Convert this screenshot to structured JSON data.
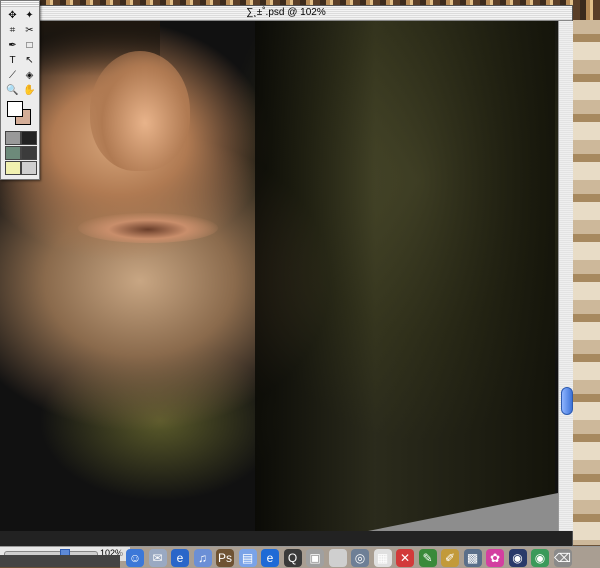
{
  "window": {
    "title": "∑¸±˚.psd @ 102%"
  },
  "status": {
    "zoom_level": "102%",
    "zoom_fraction": 0.66
  },
  "tools": [
    {
      "name": "move-tool-icon",
      "glyph": "✥"
    },
    {
      "name": "wand-tool-icon",
      "glyph": "✦"
    },
    {
      "name": "crop-tool-icon",
      "glyph": "⌗"
    },
    {
      "name": "slice-tool-icon",
      "glyph": "✂"
    },
    {
      "name": "pen-tool-icon",
      "glyph": "✒"
    },
    {
      "name": "rectangle-tool-icon",
      "glyph": "□"
    },
    {
      "name": "type-tool-icon",
      "glyph": "T"
    },
    {
      "name": "path-select-tool-icon",
      "glyph": "↖"
    },
    {
      "name": "eyedropper-tool-icon",
      "glyph": "⟋"
    },
    {
      "name": "paint-bucket-tool-icon",
      "glyph": "◈"
    },
    {
      "name": "zoom-tool-icon",
      "glyph": "🔍"
    },
    {
      "name": "hand-tool-icon",
      "glyph": "✋"
    }
  ],
  "colors": {
    "foreground": "#ffffff",
    "background": "#d4ad97",
    "scroll_thumb": "#3d73d8"
  },
  "dock": [
    {
      "name": "finder-icon",
      "color": "#3c78d8",
      "glyph": "☺"
    },
    {
      "name": "mail-icon",
      "color": "#9aa9c2",
      "glyph": "✉"
    },
    {
      "name": "ie-icon",
      "color": "#2a66c9",
      "glyph": "e"
    },
    {
      "name": "itunes-icon",
      "color": "#6b8fd6",
      "glyph": "♫"
    },
    {
      "name": "photoshop-icon",
      "color": "#6e5232",
      "glyph": "Ps"
    },
    {
      "name": "folder-icon",
      "color": "#7aa3e8",
      "glyph": "▤"
    },
    {
      "name": "internet-explorer-icon",
      "color": "#1e6ad6",
      "glyph": "e"
    },
    {
      "name": "quicktime-icon",
      "color": "#3a3a3a",
      "glyph": "Q"
    },
    {
      "name": "preview-icon",
      "color": "#a0a0a0",
      "glyph": "▣"
    },
    {
      "name": "apple-icon",
      "color": "#cfcfcf",
      "glyph": ""
    },
    {
      "name": "sherlock-icon",
      "color": "#6e7f96",
      "glyph": "◎"
    },
    {
      "name": "ical-icon",
      "color": "#e0e0e0",
      "glyph": "▦"
    },
    {
      "name": "stop-icon",
      "color": "#d23a3a",
      "glyph": "✕"
    },
    {
      "name": "pencil-app-icon",
      "color": "#3a8a3a",
      "glyph": "✎"
    },
    {
      "name": "brush-app-icon",
      "color": "#c29a3a",
      "glyph": "✐"
    },
    {
      "name": "image-app-icon",
      "color": "#5a6f8a",
      "glyph": "▩"
    },
    {
      "name": "flower-icon",
      "color": "#d33fa0",
      "glyph": "✿"
    },
    {
      "name": "spiral-icon",
      "color": "#2a3a6a",
      "glyph": "◉"
    },
    {
      "name": "eye-icon",
      "color": "#3a9a5a",
      "glyph": "◉"
    },
    {
      "name": "trash-icon",
      "color": "#8a8a8a",
      "glyph": "⌫"
    }
  ]
}
